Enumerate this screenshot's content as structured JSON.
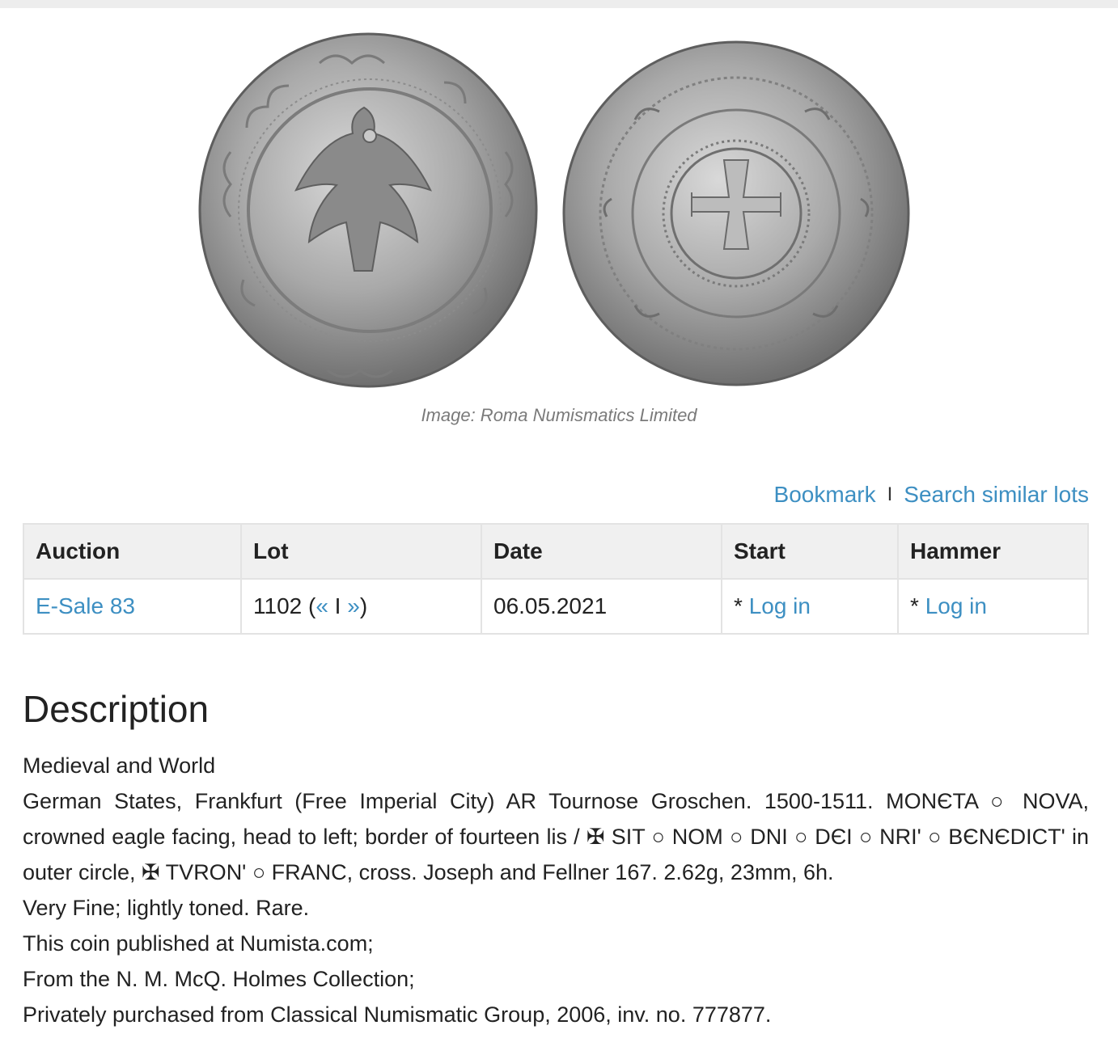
{
  "image": {
    "alt": "Coin obverse and reverse",
    "caption": "Image: Roma Numismatics Limited"
  },
  "actions": {
    "bookmark": "Bookmark",
    "separator": "I",
    "search_similar": "Search similar lots"
  },
  "table": {
    "headers": [
      "Auction",
      "Lot",
      "Date",
      "Start",
      "Hammer"
    ],
    "row": {
      "auction": "E-Sale 83",
      "lot_number": "1102 (",
      "lot_prev": "«",
      "lot_sep": " I ",
      "lot_next": "»",
      "lot_close": ")",
      "date": "06.05.2021",
      "start_prefix": "* ",
      "start_link": "Log in",
      "hammer_prefix": "* ",
      "hammer_link": "Log in"
    }
  },
  "description": {
    "title": "Description",
    "lines": [
      "Medieval and World",
      "German States, Frankfurt (Free Imperial City) AR Tournose Groschen. 1500-1511. MONЄTA ○ NOVA, crowned eagle facing, head to left; border of fourteen lis / ✠ SIT ○ NOM ○ DNI ○ DЄI ○ NRI' ○ BЄNЄDICT' in outer circle, ✠ TVRON' ○ FRANC, cross. Joseph and Fellner 167. 2.62g, 23mm, 6h.",
      "Very Fine; lightly toned. Rare.",
      "This coin published at Numista.com;",
      "From the N. M. McQ. Holmes Collection;",
      "Privately purchased from Classical Numismatic Group, 2006, inv. no. 777877."
    ]
  },
  "colors": {
    "link": "#3d8fc2",
    "header_bg": "#f0f0f0",
    "border": "#e3e3e3",
    "caption": "#7a7a7a"
  }
}
